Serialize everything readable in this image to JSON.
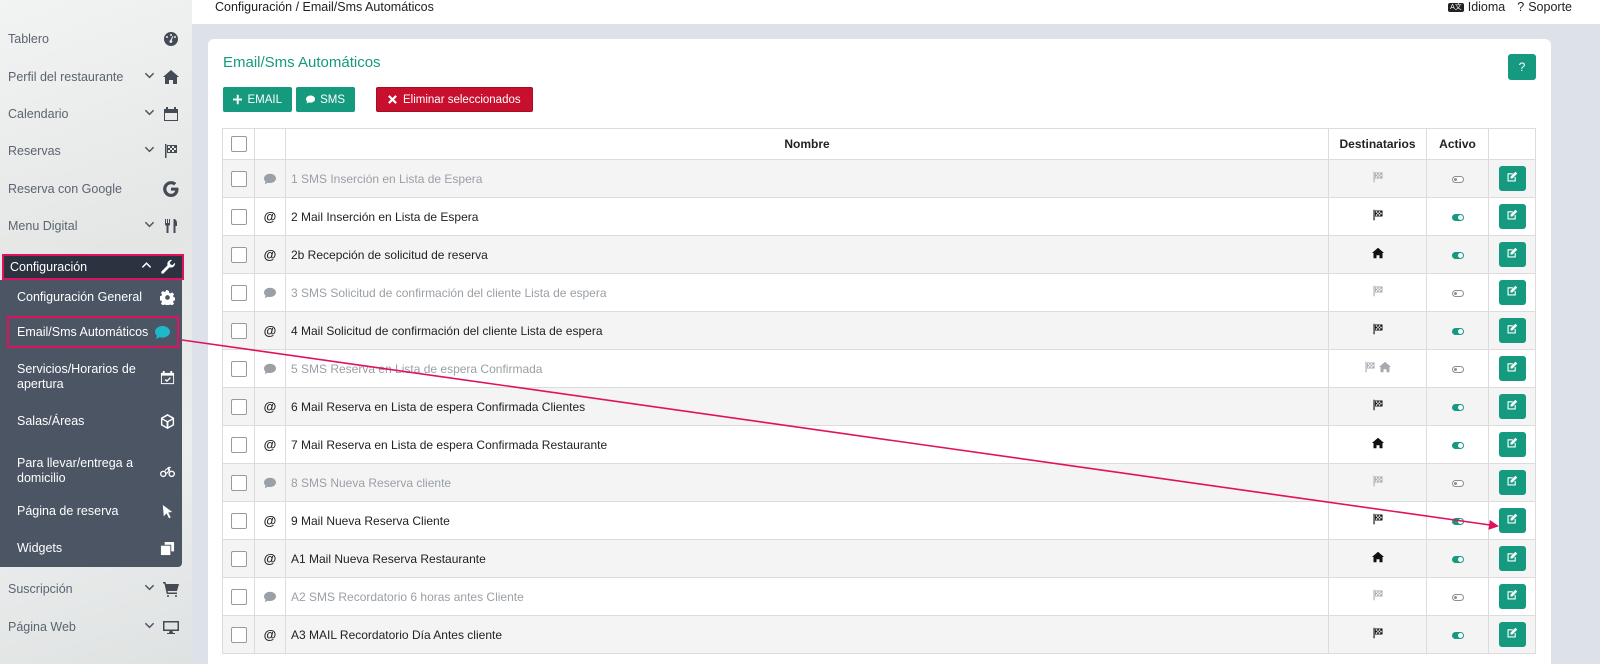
{
  "breadcrumb": "Configuración / Email/Sms Automáticos",
  "top_links": {
    "language": "Idioma",
    "support": "Soporte",
    "lang_badge": "A文"
  },
  "sidebar": {
    "items": [
      {
        "label": "Tablero",
        "icon": "dashboard-icon",
        "chevron": false
      },
      {
        "label": "Perfil del restaurante",
        "icon": "home-icon",
        "chevron": true
      },
      {
        "label": "Calendario",
        "icon": "calendar-icon",
        "chevron": true
      },
      {
        "label": "Reservas",
        "icon": "flag-checkered-icon",
        "chevron": true
      },
      {
        "label": "Reserva con Google",
        "icon": "google-icon",
        "chevron": false
      },
      {
        "label": "Menu Digital",
        "icon": "utensils-icon",
        "chevron": true
      }
    ],
    "active": {
      "label": "Configuración",
      "icon": "wrench-icon"
    },
    "submenu": [
      {
        "label": "Configuración General",
        "icon": "gear-icon"
      },
      {
        "label": "Email/Sms Automáticos",
        "icon": "comment-icon"
      },
      {
        "label": "Servicios/Horarios de apertura",
        "icon": "calendar-check-icon"
      },
      {
        "label": "Salas/Áreas",
        "icon": "cube-icon"
      },
      {
        "label": "Para llevar/entrega a domicilio",
        "icon": "bicycle-icon"
      },
      {
        "label": "Página de reserva",
        "icon": "cursor-icon"
      },
      {
        "label": "Widgets",
        "icon": "clone-icon"
      }
    ],
    "bottom_items": [
      {
        "label": "Suscripción",
        "icon": "cart-icon"
      },
      {
        "label": "Página Web",
        "icon": "monitor-icon"
      }
    ]
  },
  "card": {
    "title": "Email/Sms Automáticos",
    "help_label": "?",
    "buttons": {
      "email": "EMAIL",
      "sms": "SMS",
      "delete": "Eliminar seleccionados"
    }
  },
  "table": {
    "headers": {
      "name": "Nombre",
      "recipients": "Destinatarios",
      "active": "Activo"
    },
    "rows": [
      {
        "type": "sms",
        "name": "1 SMS Inserción en Lista de Espera",
        "recipients": [
          "flag"
        ],
        "active": false
      },
      {
        "type": "mail",
        "name": "2 Mail Inserción en Lista de Espera",
        "recipients": [
          "flag"
        ],
        "active": true
      },
      {
        "type": "mail",
        "name": "2b Recepción de solicitud de reserva",
        "recipients": [
          "home"
        ],
        "active": true
      },
      {
        "type": "sms",
        "name": "3 SMS Solicitud de confirmación del cliente Lista de espera",
        "recipients": [
          "flag"
        ],
        "active": false
      },
      {
        "type": "mail",
        "name": "4 Mail Solicitud de confirmación del cliente Lista de espera",
        "recipients": [
          "flag"
        ],
        "active": true
      },
      {
        "type": "sms",
        "name": "5 SMS Reserva en Lista de espera Confirmada",
        "recipients": [
          "flag",
          "home"
        ],
        "active": false
      },
      {
        "type": "mail",
        "name": "6 Mail Reserva en Lista de espera Confirmada Clientes",
        "recipients": [
          "flag"
        ],
        "active": true
      },
      {
        "type": "mail",
        "name": "7 Mail Reserva en Lista de espera Confirmada Restaurante",
        "recipients": [
          "home"
        ],
        "active": true
      },
      {
        "type": "sms",
        "name": "8 SMS Nueva Reserva cliente",
        "recipients": [
          "flag"
        ],
        "active": false
      },
      {
        "type": "mail",
        "name": "9 Mail Nueva Reserva Cliente",
        "recipients": [
          "flag"
        ],
        "active": true
      },
      {
        "type": "mail",
        "name": "A1 Mail Nueva Reserva Restaurante",
        "recipients": [
          "home"
        ],
        "active": true
      },
      {
        "type": "sms",
        "name": "A2 SMS Recordatorio 6 horas antes Cliente",
        "recipients": [
          "flag"
        ],
        "active": false
      },
      {
        "type": "mail",
        "name": "A3 MAIL Recordatorio Día Antes cliente",
        "recipients": [
          "flag"
        ],
        "active": true
      }
    ]
  },
  "colors": {
    "accent": "#169a7f",
    "danger": "#c8102e",
    "highlight": "#e0115f",
    "sidebar_dark": "#2c3340",
    "submenu_bg": "#4b5563"
  }
}
